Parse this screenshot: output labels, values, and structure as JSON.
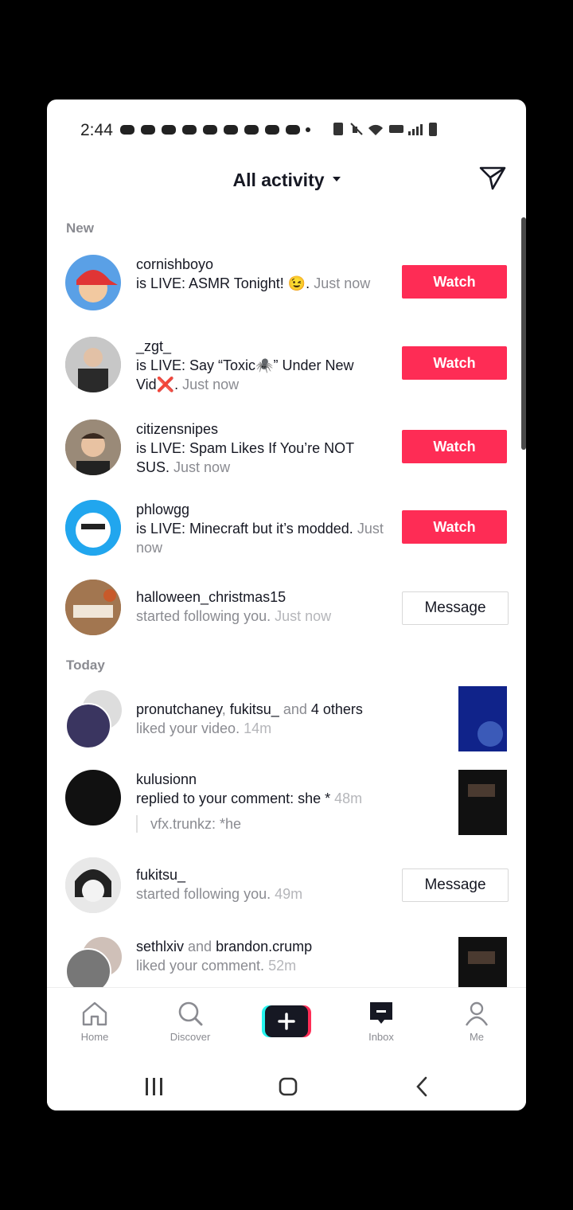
{
  "status_bar": {
    "time": "2:44"
  },
  "header": {
    "title": "All activity"
  },
  "sections": {
    "new": "New",
    "today": "Today"
  },
  "new_items": [
    {
      "username": "cornishboyo",
      "line1": "is LIVE: ASMR Tonight! 😉.",
      "time": "Just now",
      "action": "Watch"
    },
    {
      "username": "_zgt_",
      "line1": "is LIVE: Say “Toxic🕷️” Under New Vid❌.",
      "time": "Just now",
      "action": "Watch"
    },
    {
      "username": "citizensnipes",
      "line1": "is LIVE: Spam Likes If You’re NOT SUS.",
      "time": "Just now",
      "action": "Watch"
    },
    {
      "username": "phlowgg",
      "line1": "is LIVE: Minecraft but it’s modded.",
      "time": "Just now",
      "action": "Watch"
    },
    {
      "username": "halloween_christmas15",
      "line1": "started following you.",
      "time": "Just now",
      "action": "Message"
    }
  ],
  "today_items": [
    {
      "user1": "pronutchaney",
      "sep": ", ",
      "user2": "fukitsu_",
      "and": " and ",
      "others": "4 others",
      "line": "liked your video.",
      "time": "14m"
    },
    {
      "username": "kulusionn",
      "line": "replied to your comment: she *",
      "time": "48m",
      "quote": "vfx.trunkz: *he"
    },
    {
      "username": "fukitsu_",
      "line": "started following you.",
      "time": "49m",
      "action": "Message"
    },
    {
      "user1": "sethlxiv",
      "and": " and ",
      "user2": "brandon.crump",
      "line": "liked your comment.",
      "time": "52m"
    }
  ],
  "nav": {
    "home": "Home",
    "discover": "Discover",
    "inbox": "Inbox",
    "me": "Me"
  },
  "colors": {
    "accent": "#fe2c55",
    "text": "#161823",
    "muted": "#8a8b91"
  }
}
